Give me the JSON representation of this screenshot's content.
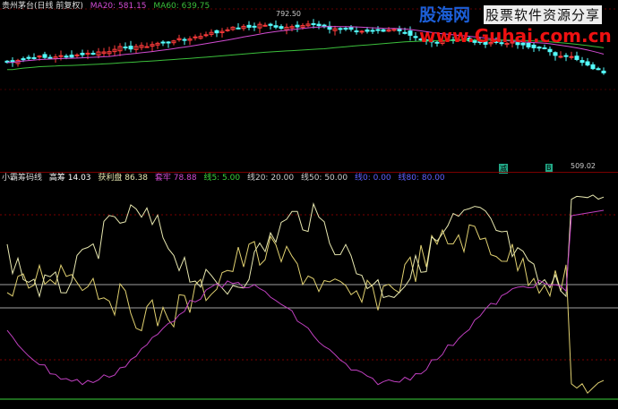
{
  "main_legend": {
    "title": "贵州茅台(日线 前复权)",
    "ma20": "MA20: 581.15",
    "ma60": "MA60: 639.75"
  },
  "price_labels": {
    "high": "792.50",
    "low": "509.02"
  },
  "indicator_legend": {
    "name": "小霸筹码线",
    "v1": "高筹 14.03",
    "v2": "获利盘 86.38",
    "v3": "套牢 78.88",
    "v4": "线5: 5.00",
    "v5": "线20: 20.00",
    "v6": "线50: 50.00",
    "v7": "线0: 0.00",
    "v8": "线80: 80.00"
  },
  "markers": {
    "buy": "减",
    "sell": "B"
  },
  "watermark": {
    "brand": "股海网",
    "slogan": "股票软件资源分享",
    "url": "www.Guhai.com.cn"
  },
  "colors": {
    "bg": "#000000",
    "up_candle": "#ff3b3b",
    "down_candle": "#54ffff",
    "ma20": "#d24bd2",
    "ma60": "#3bbf3b",
    "profit_line": "#e8e8b0",
    "trapped_line": "#e0d070",
    "chip_line": "#c040c0",
    "level_line": "#a0a0a0",
    "green_level": "#3bd23b"
  }
}
